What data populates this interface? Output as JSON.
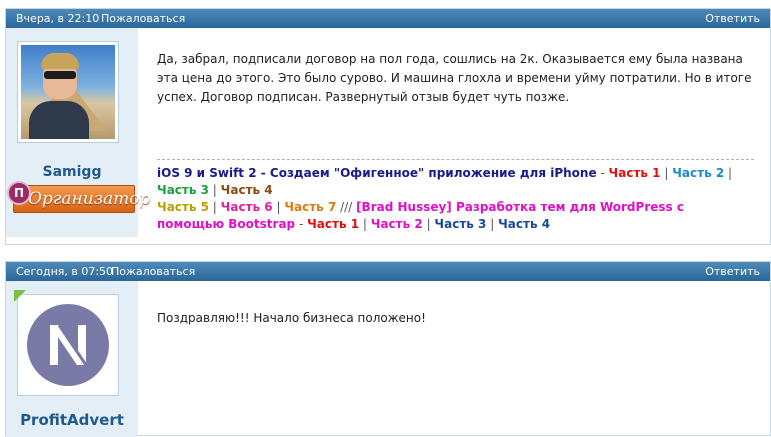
{
  "posts": [
    {
      "date": "Вчера, в 22:10",
      "report_label": "Пожаловаться",
      "reply_label": "Ответить",
      "author": "Samigg",
      "badge_letter": "П",
      "badge_label": "Организатор",
      "message": "Да, забрал, подписали договор на пол года, сошлись на 2к. Оказывается ему была названа эта цена до этого. Это было сурово. И машина глохла и времени уйму потратили. Но в итоге успех. Договор подписан. Развернутый отзыв будет чуть позже.",
      "signature": {
        "course1_title": "iOS 9 и Swift 2 - Создаем \"Офигенное\" приложение для iPhone",
        "dash": " - ",
        "sep": " | ",
        "slashes": " /// ",
        "course1_parts": [
          "Часть 1",
          "Часть 2",
          "Часть 3",
          "Часть 4",
          "Часть 5",
          "Часть 6",
          "Часть 7"
        ],
        "course2_title": "[Brad Hussey] Разработка тем для WordPress с помощью Bootstrap",
        "course2_parts": [
          "Часть 1",
          "Часть 2",
          "Часть 3",
          "Часть 4"
        ]
      }
    },
    {
      "date": "Сегодня, в 07:50",
      "report_label": "Пожаловаться",
      "reply_label": "Ответить",
      "author": "ProfitAdvert",
      "message": "Поздравляю!!! Начало бизнеса положено!"
    }
  ],
  "colors": {
    "header": "#3a78ab",
    "author_bg": "#e4eef7",
    "c1_title": "#1a1a8c",
    "c1_p1": "#e01010",
    "c1_p2": "#1a8ad0",
    "c1_p3": "#1aa040",
    "c1_p4": "#8a4a10",
    "c1_p5": "#b8a000",
    "c1_p6": "#e0209a",
    "c1_p7": "#e07a10",
    "c2_title": "#e010c8",
    "c2_p1": "#e01010",
    "c2_p2": "#e010c8",
    "c2_p3": "#1a4a9a",
    "c2_p4": "#1a4a9a",
    "logo": "#7a7aa6"
  },
  "icons": {
    "avatar2": "n-logo-icon",
    "online": "online-marker-icon"
  }
}
